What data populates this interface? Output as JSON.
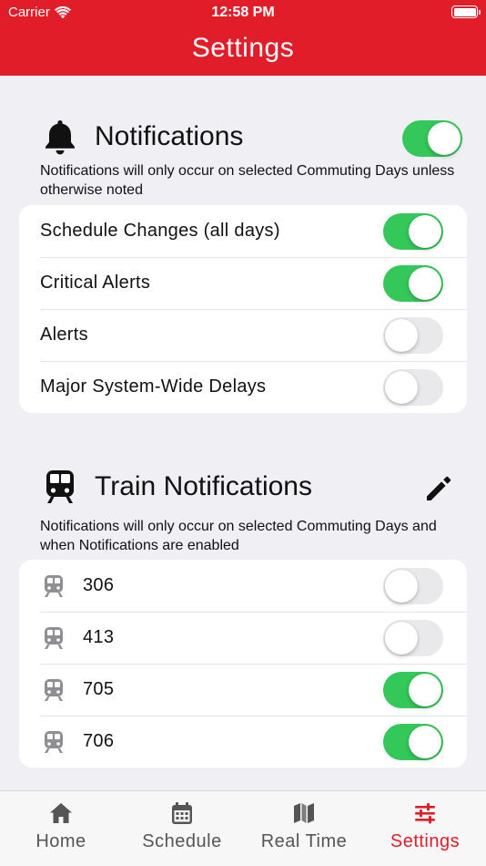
{
  "status_bar": {
    "carrier": "Carrier",
    "time": "12:58 PM"
  },
  "header": {
    "title": "Settings"
  },
  "notifications": {
    "title": "Notifications",
    "enabled": true,
    "note": "Notifications will only occur on selected Commuting Days unless otherwise noted",
    "items": [
      {
        "label": "Schedule Changes (all days)",
        "on": true
      },
      {
        "label": "Critical Alerts",
        "on": true
      },
      {
        "label": "Alerts",
        "on": false
      },
      {
        "label": "Major System-Wide Delays",
        "on": false
      }
    ]
  },
  "train_notifications": {
    "title": "Train Notifications",
    "note": "Notifications will only occur on selected Commuting Days and when Notifications are enabled",
    "items": [
      {
        "label": "306",
        "on": false
      },
      {
        "label": "413",
        "on": false
      },
      {
        "label": "705",
        "on": true
      },
      {
        "label": "706",
        "on": true
      }
    ]
  },
  "tabbar": {
    "tabs": [
      {
        "label": "Home",
        "icon": "home-icon",
        "active": false
      },
      {
        "label": "Schedule",
        "icon": "calendar-icon",
        "active": false
      },
      {
        "label": "Real Time",
        "icon": "map-icon",
        "active": false
      },
      {
        "label": "Settings",
        "icon": "sliders-icon",
        "active": true
      }
    ]
  },
  "colors": {
    "accent": "#e11d2a",
    "toggle_on": "#34c759",
    "toggle_off": "#e9e9eb"
  }
}
